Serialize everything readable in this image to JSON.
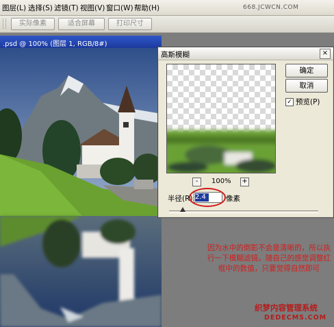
{
  "menubar": {
    "items": [
      "图层(L)",
      "选择(S)",
      "滤镜(T)",
      "视图(V)",
      "窗口(W)",
      "帮助(H)"
    ],
    "watermark": "668.JCWCN.COM"
  },
  "optionsbar": {
    "buttons": [
      "实际像素",
      "适合屏幕",
      "打印尺寸"
    ]
  },
  "document": {
    "title": ".psd @ 100% (图层 1, RGB/8#)"
  },
  "dialog": {
    "title": "高斯模糊",
    "close_glyph": "×",
    "ok_label": "确定",
    "cancel_label": "取消",
    "preview_checkbox_label": "预览(P)",
    "preview_checked": true,
    "zoom_minus": "-",
    "zoom_plus": "+",
    "zoom_level": "100%",
    "radius_label": "半径(R):",
    "radius_value": "2.4",
    "radius_unit": "像素"
  },
  "annotation": {
    "text": "因为水中的倒影不会是清晰的，所以执行一下模糊滤镜。随自己的感觉调整红框中的数值，只要觉得自然即可"
  },
  "watermark": {
    "cn": "织梦内容管理系统",
    "en": "DEDECMS.COM"
  },
  "colors": {
    "annotation": "#d21d1d",
    "selection": "#1f3b9c",
    "titlebar": "#2f57c9"
  }
}
